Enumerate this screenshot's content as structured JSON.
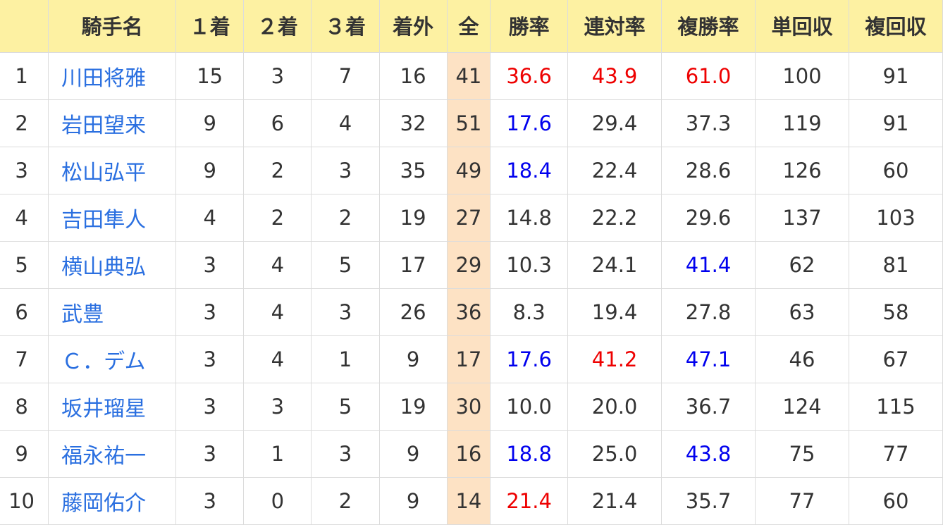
{
  "headers": [
    "",
    "騎手名",
    "１着",
    "２着",
    "３着",
    "着外",
    "全",
    "勝率",
    "連対率",
    "複勝率",
    "単回収",
    "複回収"
  ],
  "colors": {
    "header_bg": "#fdf1a2",
    "total_bg": "#fde2c4",
    "link": "#2a6fe0",
    "high": "#ee0000",
    "mid": "#0000ee",
    "border": "#dcdcdc"
  },
  "rows": [
    {
      "rank": "1",
      "name": "川田将雅",
      "first": "15",
      "second": "3",
      "third": "7",
      "out": "16",
      "total": "41",
      "win_rate": "36.6",
      "win_rate_color": "red",
      "quinella_rate": "43.9",
      "quinella_rate_color": "red",
      "show_rate": "61.0",
      "show_rate_color": "red",
      "win_return": "100",
      "show_return": "91"
    },
    {
      "rank": "2",
      "name": "岩田望来",
      "first": "9",
      "second": "6",
      "third": "4",
      "out": "32",
      "total": "51",
      "win_rate": "17.6",
      "win_rate_color": "blue",
      "quinella_rate": "29.4",
      "quinella_rate_color": "black",
      "show_rate": "37.3",
      "show_rate_color": "black",
      "win_return": "119",
      "show_return": "91"
    },
    {
      "rank": "3",
      "name": "松山弘平",
      "first": "9",
      "second": "2",
      "third": "3",
      "out": "35",
      "total": "49",
      "win_rate": "18.4",
      "win_rate_color": "blue",
      "quinella_rate": "22.4",
      "quinella_rate_color": "black",
      "show_rate": "28.6",
      "show_rate_color": "black",
      "win_return": "126",
      "show_return": "60"
    },
    {
      "rank": "4",
      "name": "吉田隼人",
      "first": "4",
      "second": "2",
      "third": "2",
      "out": "19",
      "total": "27",
      "win_rate": "14.8",
      "win_rate_color": "black",
      "quinella_rate": "22.2",
      "quinella_rate_color": "black",
      "show_rate": "29.6",
      "show_rate_color": "black",
      "win_return": "137",
      "show_return": "103"
    },
    {
      "rank": "5",
      "name": "横山典弘",
      "first": "3",
      "second": "4",
      "third": "5",
      "out": "17",
      "total": "29",
      "win_rate": "10.3",
      "win_rate_color": "black",
      "quinella_rate": "24.1",
      "quinella_rate_color": "black",
      "show_rate": "41.4",
      "show_rate_color": "blue",
      "win_return": "62",
      "show_return": "81"
    },
    {
      "rank": "6",
      "name": "武豊",
      "first": "3",
      "second": "4",
      "third": "3",
      "out": "26",
      "total": "36",
      "win_rate": "8.3",
      "win_rate_color": "black",
      "quinella_rate": "19.4",
      "quinella_rate_color": "black",
      "show_rate": "27.8",
      "show_rate_color": "black",
      "win_return": "63",
      "show_return": "58"
    },
    {
      "rank": "7",
      "name": "Ｃ．デム",
      "first": "3",
      "second": "4",
      "third": "1",
      "out": "9",
      "total": "17",
      "win_rate": "17.6",
      "win_rate_color": "blue",
      "quinella_rate": "41.2",
      "quinella_rate_color": "red",
      "show_rate": "47.1",
      "show_rate_color": "blue",
      "win_return": "46",
      "show_return": "67"
    },
    {
      "rank": "8",
      "name": "坂井瑠星",
      "first": "3",
      "second": "3",
      "third": "5",
      "out": "19",
      "total": "30",
      "win_rate": "10.0",
      "win_rate_color": "black",
      "quinella_rate": "20.0",
      "quinella_rate_color": "black",
      "show_rate": "36.7",
      "show_rate_color": "black",
      "win_return": "124",
      "show_return": "115"
    },
    {
      "rank": "9",
      "name": "福永祐一",
      "first": "3",
      "second": "1",
      "third": "3",
      "out": "9",
      "total": "16",
      "win_rate": "18.8",
      "win_rate_color": "blue",
      "quinella_rate": "25.0",
      "quinella_rate_color": "black",
      "show_rate": "43.8",
      "show_rate_color": "blue",
      "win_return": "75",
      "show_return": "77"
    },
    {
      "rank": "10",
      "name": "藤岡佑介",
      "first": "3",
      "second": "0",
      "third": "2",
      "out": "9",
      "total": "14",
      "win_rate": "21.4",
      "win_rate_color": "red",
      "quinella_rate": "21.4",
      "quinella_rate_color": "black",
      "show_rate": "35.7",
      "show_rate_color": "black",
      "win_return": "77",
      "show_return": "60"
    }
  ]
}
